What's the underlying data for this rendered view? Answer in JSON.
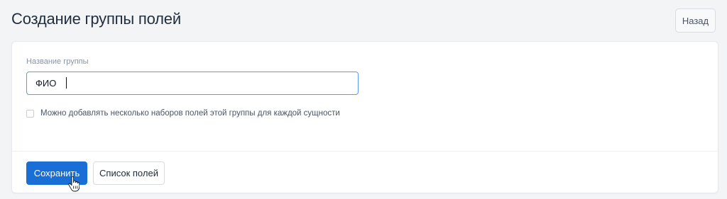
{
  "header": {
    "title": "Создание группы полей",
    "back_label": "Назад"
  },
  "form": {
    "name_label": "Название группы",
    "name_value": "ФИО",
    "multiple_sets_checkbox": {
      "label": "Можно добавлять несколько наборов полей этой группы для каждой сущности",
      "checked": false
    }
  },
  "footer": {
    "save_label": "Сохранить",
    "fields_list_label": "Список полей"
  },
  "colors": {
    "primary": "#1a6fd6",
    "input_focus_border": "#5b9bf0",
    "background": "#f3f4f6"
  },
  "icons": {
    "mouse_cursor": "hand-pointer-icon"
  }
}
